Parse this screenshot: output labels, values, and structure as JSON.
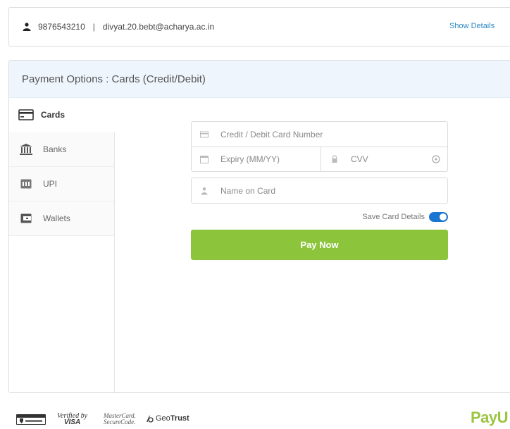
{
  "user": {
    "phone": "9876543210",
    "separator": "|",
    "email": "divyat.20.bebt@acharya.ac.in",
    "show_details_label": "Show Details"
  },
  "panel": {
    "title": "Payment Options : Cards (Credit/Debit)"
  },
  "sidebar": {
    "items": [
      {
        "label": "Cards",
        "icon": "card-icon",
        "active": true
      },
      {
        "label": "Banks",
        "icon": "bank-icon",
        "active": false
      },
      {
        "label": "UPI",
        "icon": "upi-icon",
        "active": false
      },
      {
        "label": "Wallets",
        "icon": "wallet-icon",
        "active": false
      }
    ]
  },
  "form": {
    "card_number_placeholder": "Credit / Debit Card Number",
    "expiry_placeholder": "Expiry (MM/YY)",
    "cvv_placeholder": "CVV",
    "name_placeholder": "Name on Card",
    "save_card_label": "Save Card Details",
    "save_card_enabled": true,
    "pay_button_label": "Pay Now"
  },
  "footer": {
    "visa_top": "Verified by",
    "visa_bottom": "VISA",
    "mc_top": "MasterCard.",
    "mc_bottom": "SecureCode.",
    "geotrust_a": "Geo",
    "geotrust_b": "Trust",
    "brand": "PayU"
  },
  "colors": {
    "accent_blue": "#1a76d2",
    "link_blue": "#2a86c3",
    "pay_green": "#8cc43c",
    "header_bg": "#eef5fc"
  }
}
